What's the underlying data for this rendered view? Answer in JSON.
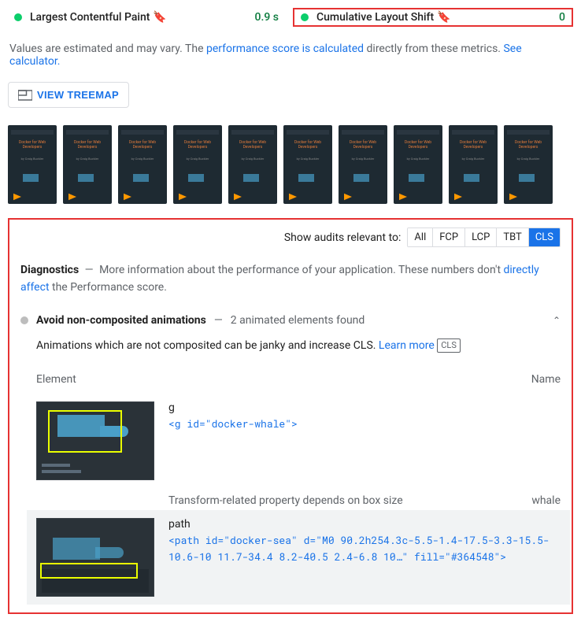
{
  "metrics": {
    "lcp": {
      "label": "Largest Contentful Paint",
      "value": "0.9 s"
    },
    "cls": {
      "label": "Cumulative Layout Shift",
      "value": "0"
    }
  },
  "note": {
    "prefix": "Values are estimated and may vary. The ",
    "link1": "performance score is calculated",
    "mid": " directly from these metrics. ",
    "link2": "See calculator."
  },
  "treemap_btn": "VIEW TREEMAP",
  "thumb": {
    "title": "Docker for Web Developers",
    "sub": "by Craig Buckler"
  },
  "filter": {
    "label": "Show audits relevant to:",
    "pills": [
      "All",
      "FCP",
      "LCP",
      "TBT",
      "CLS"
    ],
    "active": "CLS"
  },
  "diagnostics": {
    "title": "Diagnostics",
    "sub": "More information about the performance of your application. These numbers don't ",
    "link": "directly affect",
    "tail": " the Performance score."
  },
  "audit": {
    "title": "Avoid non-composited animations",
    "summary": "2 animated elements found",
    "desc_prefix": "Animations which are not composited can be janky and increase CLS. ",
    "learn": "Learn more",
    "tag": "CLS"
  },
  "table": {
    "col1": "Element",
    "col2": "Name",
    "rows": [
      {
        "name": "g",
        "code": "<g id=\"docker-whale\">",
        "sub_label": "Transform-related property depends on box size",
        "sub_right": "whale"
      },
      {
        "name": "path",
        "code": "<path id=\"docker-sea\" d=\"M0 90.2h254.3c-5.5-1.4-17.5-3.3-15.5-10.6-10 11.7-34.4 8.2-40.5 2.4-6.8 10…\" fill=\"#364548\">"
      }
    ]
  }
}
